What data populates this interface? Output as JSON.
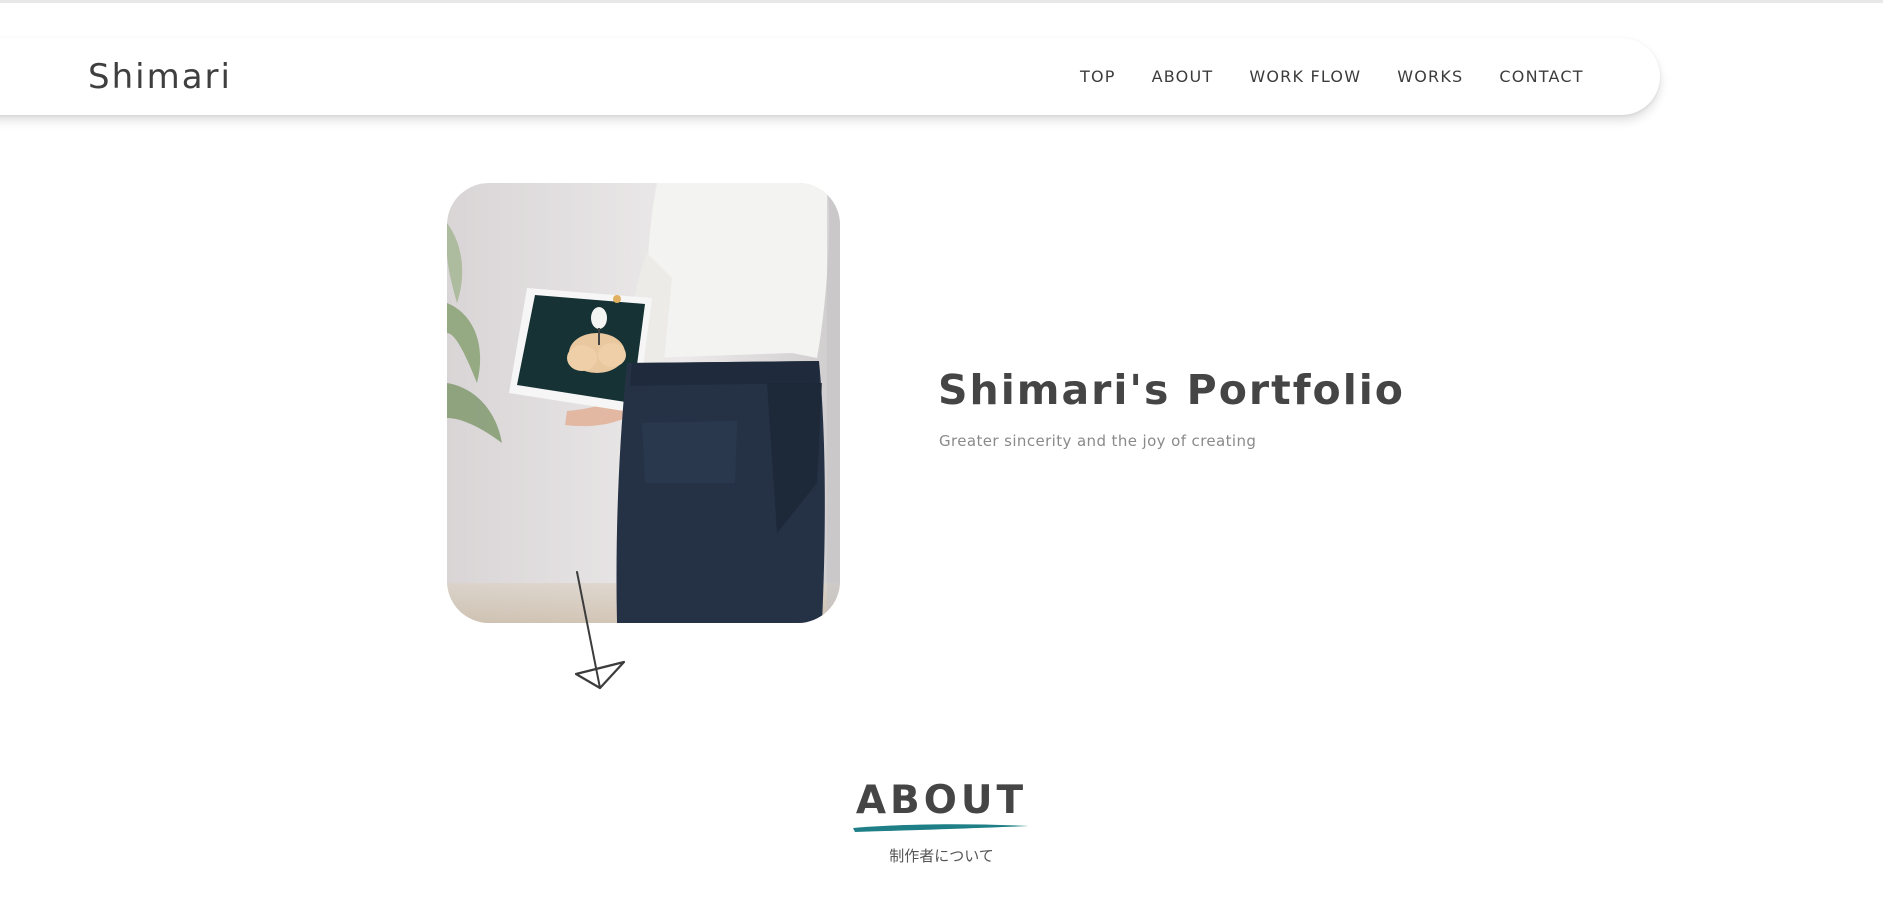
{
  "header": {
    "logo": "Shimari",
    "nav": [
      {
        "label": "TOP"
      },
      {
        "label": "ABOUT"
      },
      {
        "label": "WORK FLOW"
      },
      {
        "label": "WORKS"
      },
      {
        "label": "CONTACT"
      }
    ]
  },
  "hero": {
    "title": "Shimari's Portfolio",
    "subtitle": "Greater sincerity and the joy of creating"
  },
  "about": {
    "heading": "ABOUT",
    "subheading": "制作者について"
  },
  "colors": {
    "text": "#3c3c3c",
    "accent_underline": "#1e7f86",
    "muted": "#8a8a8a"
  }
}
